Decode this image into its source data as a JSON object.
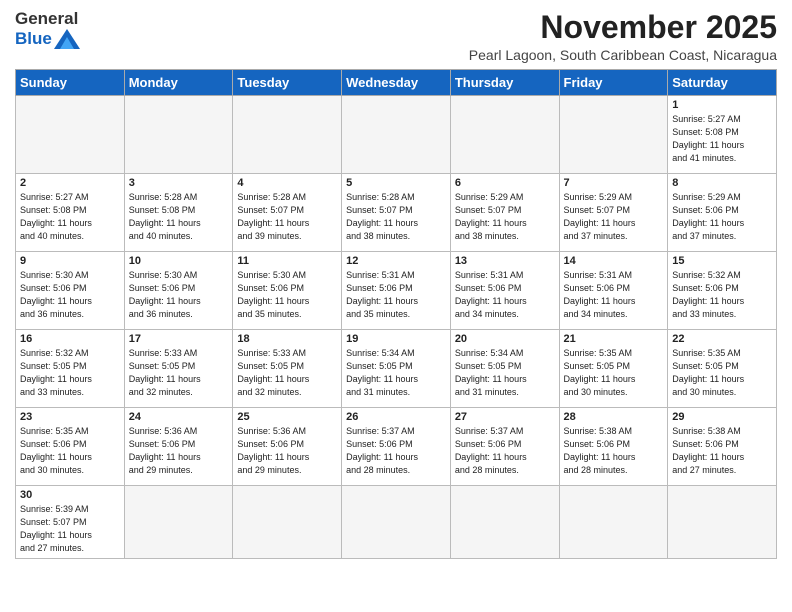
{
  "logo": {
    "text_general": "General",
    "text_blue": "Blue"
  },
  "title": "November 2025",
  "location": "Pearl Lagoon, South Caribbean Coast, Nicaragua",
  "weekdays": [
    "Sunday",
    "Monday",
    "Tuesday",
    "Wednesday",
    "Thursday",
    "Friday",
    "Saturday"
  ],
  "weeks": [
    [
      {
        "day": "",
        "info": ""
      },
      {
        "day": "",
        "info": ""
      },
      {
        "day": "",
        "info": ""
      },
      {
        "day": "",
        "info": ""
      },
      {
        "day": "",
        "info": ""
      },
      {
        "day": "",
        "info": ""
      },
      {
        "day": "1",
        "info": "Sunrise: 5:27 AM\nSunset: 5:08 PM\nDaylight: 11 hours\nand 41 minutes."
      }
    ],
    [
      {
        "day": "2",
        "info": "Sunrise: 5:27 AM\nSunset: 5:08 PM\nDaylight: 11 hours\nand 40 minutes."
      },
      {
        "day": "3",
        "info": "Sunrise: 5:28 AM\nSunset: 5:08 PM\nDaylight: 11 hours\nand 40 minutes."
      },
      {
        "day": "4",
        "info": "Sunrise: 5:28 AM\nSunset: 5:07 PM\nDaylight: 11 hours\nand 39 minutes."
      },
      {
        "day": "5",
        "info": "Sunrise: 5:28 AM\nSunset: 5:07 PM\nDaylight: 11 hours\nand 38 minutes."
      },
      {
        "day": "6",
        "info": "Sunrise: 5:29 AM\nSunset: 5:07 PM\nDaylight: 11 hours\nand 38 minutes."
      },
      {
        "day": "7",
        "info": "Sunrise: 5:29 AM\nSunset: 5:07 PM\nDaylight: 11 hours\nand 37 minutes."
      },
      {
        "day": "8",
        "info": "Sunrise: 5:29 AM\nSunset: 5:06 PM\nDaylight: 11 hours\nand 37 minutes."
      }
    ],
    [
      {
        "day": "9",
        "info": "Sunrise: 5:30 AM\nSunset: 5:06 PM\nDaylight: 11 hours\nand 36 minutes."
      },
      {
        "day": "10",
        "info": "Sunrise: 5:30 AM\nSunset: 5:06 PM\nDaylight: 11 hours\nand 36 minutes."
      },
      {
        "day": "11",
        "info": "Sunrise: 5:30 AM\nSunset: 5:06 PM\nDaylight: 11 hours\nand 35 minutes."
      },
      {
        "day": "12",
        "info": "Sunrise: 5:31 AM\nSunset: 5:06 PM\nDaylight: 11 hours\nand 35 minutes."
      },
      {
        "day": "13",
        "info": "Sunrise: 5:31 AM\nSunset: 5:06 PM\nDaylight: 11 hours\nand 34 minutes."
      },
      {
        "day": "14",
        "info": "Sunrise: 5:31 AM\nSunset: 5:06 PM\nDaylight: 11 hours\nand 34 minutes."
      },
      {
        "day": "15",
        "info": "Sunrise: 5:32 AM\nSunset: 5:06 PM\nDaylight: 11 hours\nand 33 minutes."
      }
    ],
    [
      {
        "day": "16",
        "info": "Sunrise: 5:32 AM\nSunset: 5:05 PM\nDaylight: 11 hours\nand 33 minutes."
      },
      {
        "day": "17",
        "info": "Sunrise: 5:33 AM\nSunset: 5:05 PM\nDaylight: 11 hours\nand 32 minutes."
      },
      {
        "day": "18",
        "info": "Sunrise: 5:33 AM\nSunset: 5:05 PM\nDaylight: 11 hours\nand 32 minutes."
      },
      {
        "day": "19",
        "info": "Sunrise: 5:34 AM\nSunset: 5:05 PM\nDaylight: 11 hours\nand 31 minutes."
      },
      {
        "day": "20",
        "info": "Sunrise: 5:34 AM\nSunset: 5:05 PM\nDaylight: 11 hours\nand 31 minutes."
      },
      {
        "day": "21",
        "info": "Sunrise: 5:35 AM\nSunset: 5:05 PM\nDaylight: 11 hours\nand 30 minutes."
      },
      {
        "day": "22",
        "info": "Sunrise: 5:35 AM\nSunset: 5:05 PM\nDaylight: 11 hours\nand 30 minutes."
      }
    ],
    [
      {
        "day": "23",
        "info": "Sunrise: 5:35 AM\nSunset: 5:06 PM\nDaylight: 11 hours\nand 30 minutes."
      },
      {
        "day": "24",
        "info": "Sunrise: 5:36 AM\nSunset: 5:06 PM\nDaylight: 11 hours\nand 29 minutes."
      },
      {
        "day": "25",
        "info": "Sunrise: 5:36 AM\nSunset: 5:06 PM\nDaylight: 11 hours\nand 29 minutes."
      },
      {
        "day": "26",
        "info": "Sunrise: 5:37 AM\nSunset: 5:06 PM\nDaylight: 11 hours\nand 28 minutes."
      },
      {
        "day": "27",
        "info": "Sunrise: 5:37 AM\nSunset: 5:06 PM\nDaylight: 11 hours\nand 28 minutes."
      },
      {
        "day": "28",
        "info": "Sunrise: 5:38 AM\nSunset: 5:06 PM\nDaylight: 11 hours\nand 28 minutes."
      },
      {
        "day": "29",
        "info": "Sunrise: 5:38 AM\nSunset: 5:06 PM\nDaylight: 11 hours\nand 27 minutes."
      }
    ],
    [
      {
        "day": "30",
        "info": "Sunrise: 5:39 AM\nSunset: 5:07 PM\nDaylight: 11 hours\nand 27 minutes."
      },
      {
        "day": "",
        "info": ""
      },
      {
        "day": "",
        "info": ""
      },
      {
        "day": "",
        "info": ""
      },
      {
        "day": "",
        "info": ""
      },
      {
        "day": "",
        "info": ""
      },
      {
        "day": "",
        "info": ""
      }
    ]
  ]
}
